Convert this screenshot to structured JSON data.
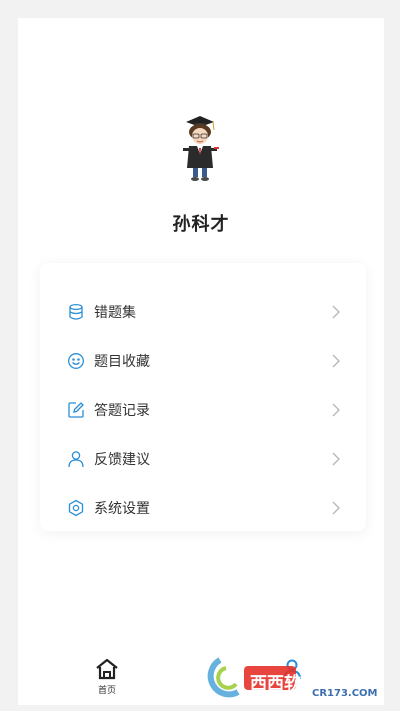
{
  "user": {
    "name": "孙科才"
  },
  "menu": [
    {
      "label": "错题集",
      "icon": "database-icon"
    },
    {
      "label": "题目收藏",
      "icon": "smile-icon"
    },
    {
      "label": "答题记录",
      "icon": "edit-icon"
    },
    {
      "label": "反馈建议",
      "icon": "user-icon"
    },
    {
      "label": "系统设置",
      "icon": "gear-icon"
    }
  ],
  "tabbar": {
    "home_label": "首页"
  },
  "watermark": {
    "brand": "西西软件园",
    "url": "CR173.COM"
  },
  "colors": {
    "accent": "#2a8fd6",
    "chevron": "#b5b5b5",
    "text": "#333333"
  }
}
